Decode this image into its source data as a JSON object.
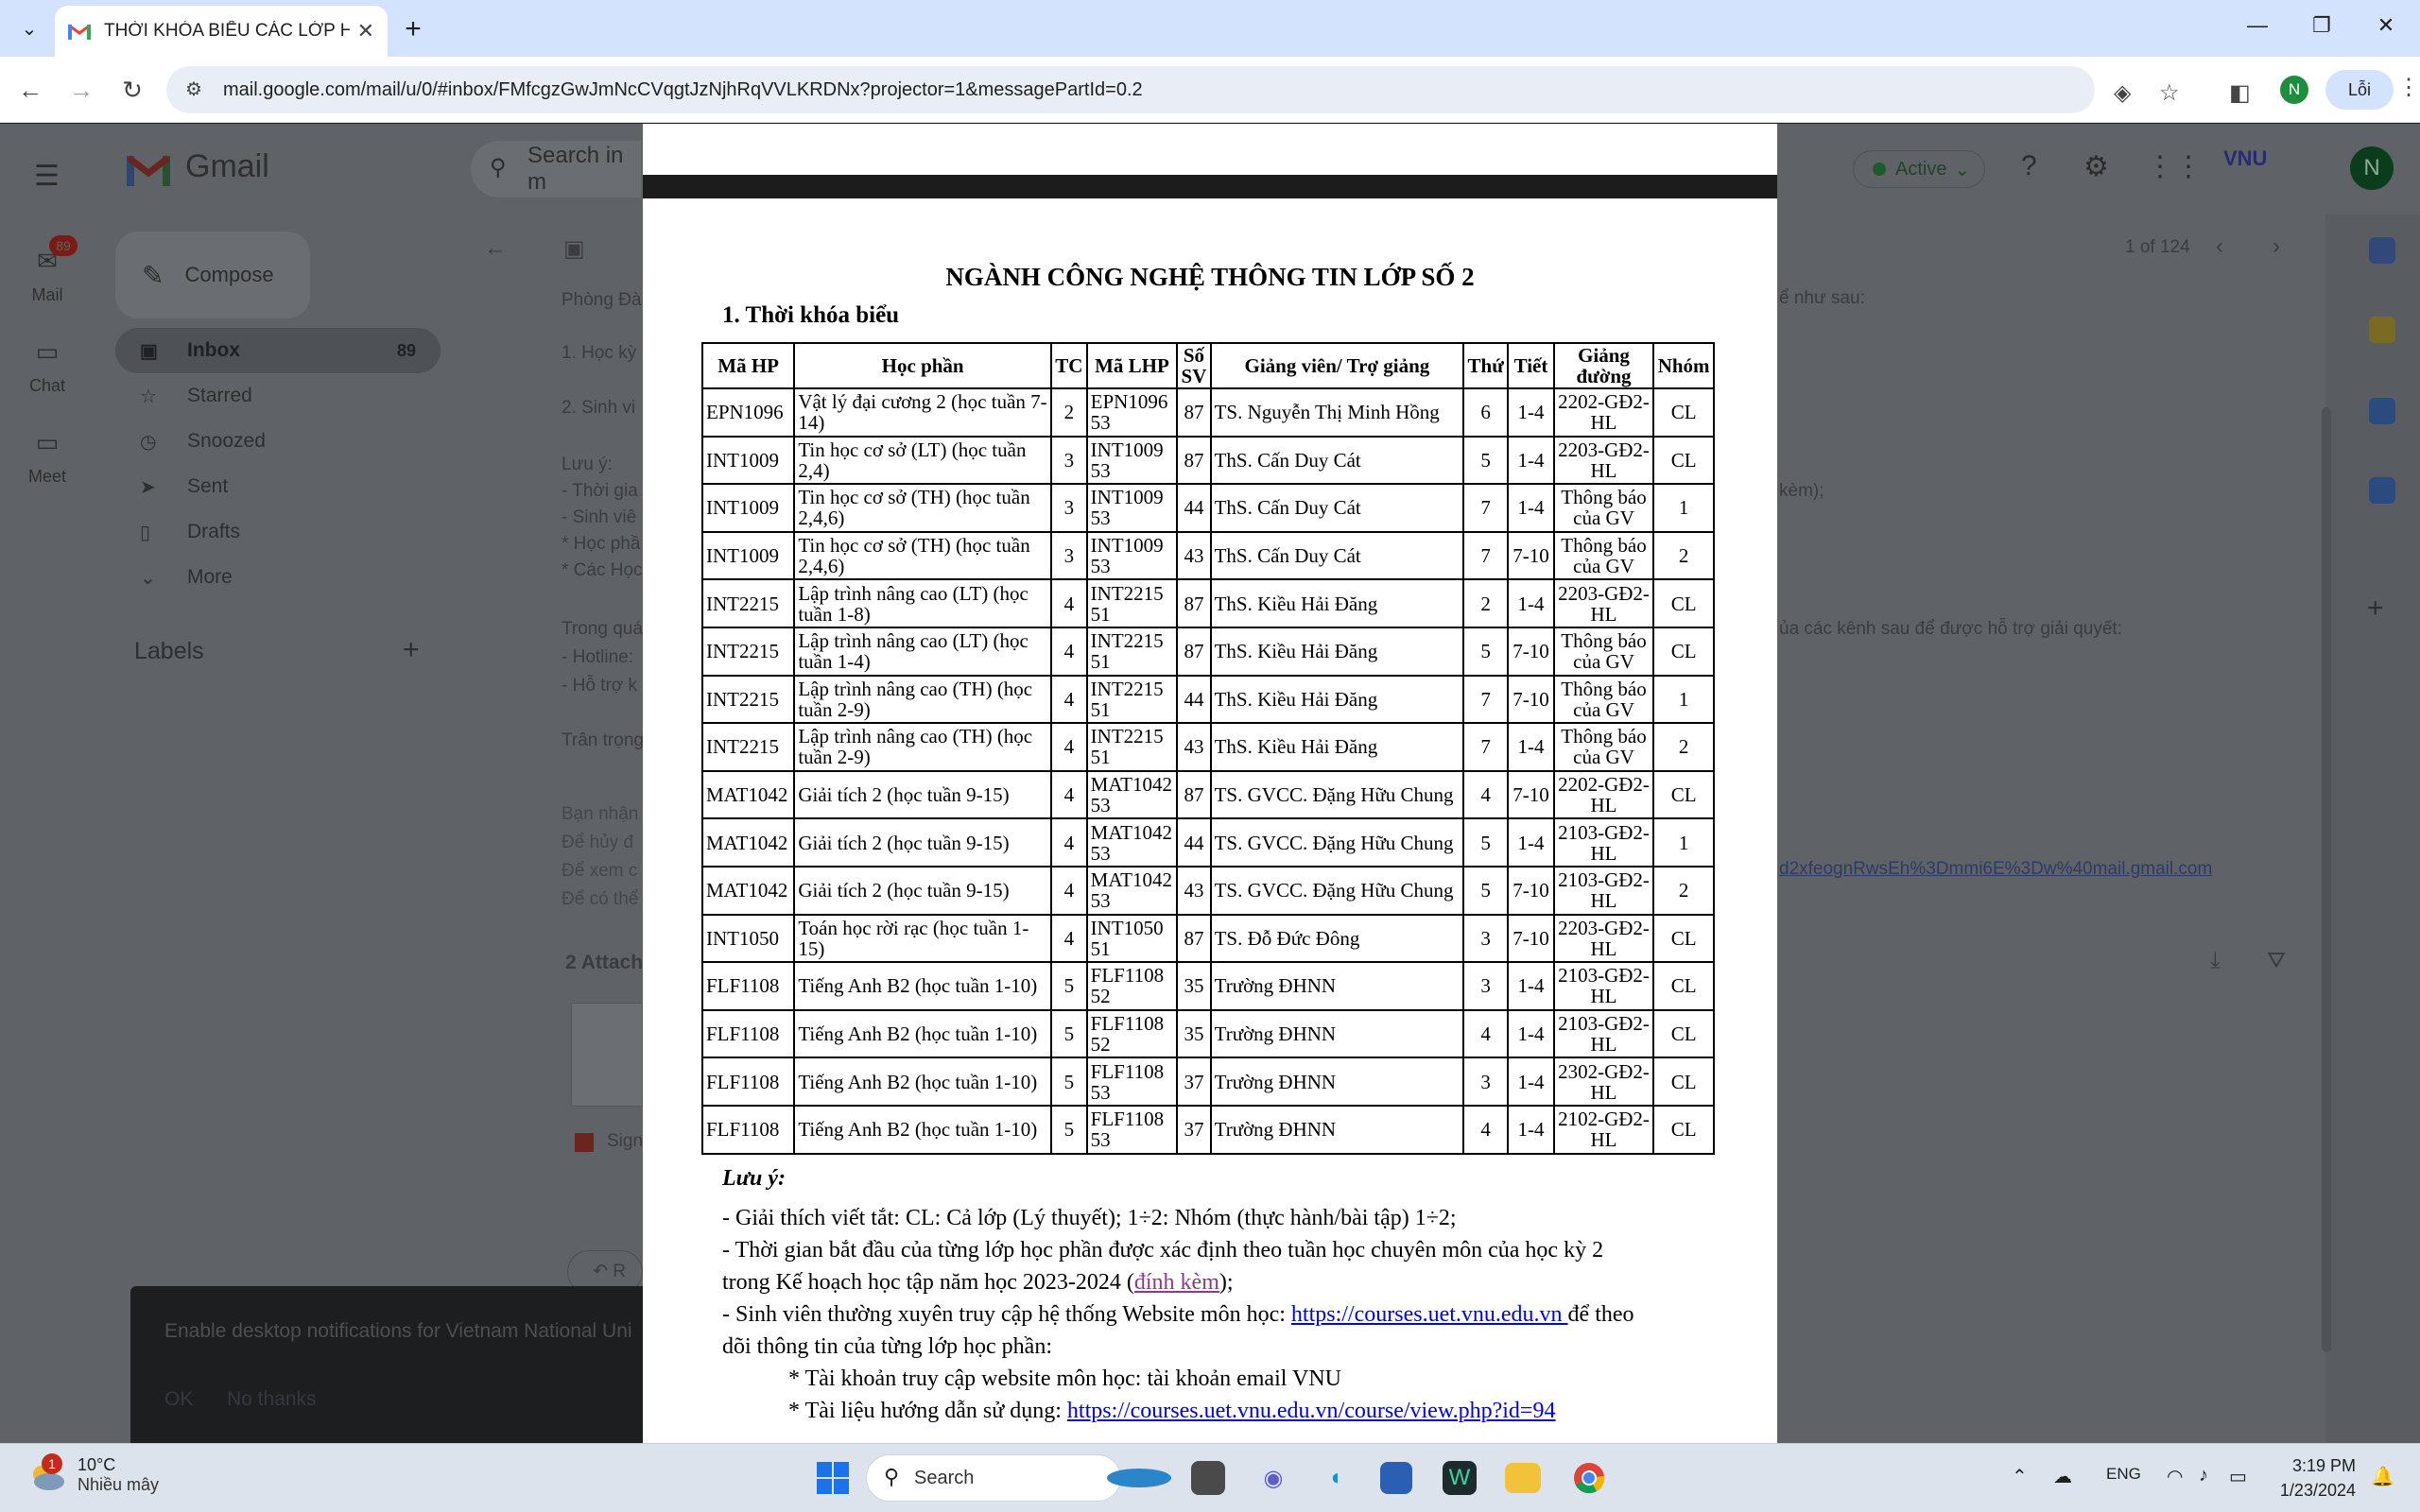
{
  "browser": {
    "tab_title": "THỜI KHÓA BIỂU CÁC LỚP HỌC",
    "url": "mail.google.com/mail/u/0/#inbox/FMfcgzGwJmNcCVqgtJzNjhRqVVLKRDNx?projector=1&messagePartId=0.2",
    "profile_initial": "N",
    "profile_label": "Lỗi"
  },
  "gmail": {
    "app_name": "Gmail",
    "search_placeholder": "Search in m",
    "status": "Active",
    "user_initial": "N",
    "vnu_logo": "VNU",
    "rail": [
      {
        "label": "Mail",
        "badge": "89"
      },
      {
        "label": "Chat"
      },
      {
        "label": "Meet"
      }
    ],
    "compose": "Compose",
    "nav": [
      {
        "label": "Inbox",
        "count": "89"
      },
      {
        "label": "Starred"
      },
      {
        "label": "Snoozed"
      },
      {
        "label": "Sent"
      },
      {
        "label": "Drafts"
      },
      {
        "label": "More"
      }
    ],
    "labels_heading": "Labels",
    "pagination": "1 of 124",
    "bg_text": {
      "line1": "Phòng Đà",
      "line2": "1. Học kỳ",
      "line3": "2. Sinh vi",
      "line4": "Lưu ý:",
      "line5": "- Thời gia",
      "line6": "- Sinh viê",
      "line7": "* Học phầ",
      "line8": "* Các Học",
      "line9": "Trong quá",
      "line10": "- Hotline:",
      "line11": "- Hỗ trợ k",
      "line12": "Trân trọng",
      "line13": "Bạn nhận",
      "line14": "Để hủy đ",
      "line15": "Để xem c",
      "line16": "Để có thể",
      "right1": "ể như sau:",
      "right2": "kèm);",
      "right3": "ủa các kênh sau để được hỗ trợ giải quyết:",
      "right4": "d2xfeognRwsEh%3Dmmi6E%3Dw%40mail.gmail.com",
      "attachments": "2 Attach",
      "sign": "Sign",
      "reply": "R"
    },
    "toast": {
      "message": "Enable desktop notifications for Vietnam National Uni",
      "ok": "OK",
      "no": "No thanks"
    }
  },
  "document": {
    "title": "NGÀNH CÔNG NGHỆ THÔNG TIN LỚP SỐ 2",
    "section": "1. Thời khóa biểu",
    "headers": [
      "Mã HP",
      "Học phần",
      "TC",
      "Mã LHP",
      "Số SV",
      "Giảng viên/ Trợ giảng",
      "Thứ",
      "Tiết",
      "Giảng đường",
      "Nhóm"
    ],
    "rows": [
      [
        "EPN1096",
        "Vật lý đại cương 2 (học tuần 7-14)",
        "2",
        "EPN1096 53",
        "87",
        "TS. Nguyễn Thị Minh Hồng",
        "6",
        "1-4",
        "2202-GĐ2-HL",
        "CL"
      ],
      [
        "INT1009",
        "Tin học cơ sở (LT) (học tuần 2,4)",
        "3",
        "INT1009 53",
        "87",
        "ThS. Cấn Duy Cát",
        "5",
        "1-4",
        "2203-GĐ2-HL",
        "CL"
      ],
      [
        "INT1009",
        "Tin học cơ sở (TH) (học tuần 2,4,6)",
        "3",
        "INT1009 53",
        "44",
        "ThS. Cấn Duy Cát",
        "7",
        "1-4",
        "Thông báo của GV",
        "1"
      ],
      [
        "INT1009",
        "Tin học cơ sở (TH) (học tuần 2,4,6)",
        "3",
        "INT1009 53",
        "43",
        "ThS. Cấn Duy Cát",
        "7",
        "7-10",
        "Thông báo của GV",
        "2"
      ],
      [
        "INT2215",
        "Lập trình nâng cao (LT) (học tuần 1-8)",
        "4",
        "INT2215 51",
        "87",
        "ThS. Kiều Hải Đăng",
        "2",
        "1-4",
        "2203-GĐ2-HL",
        "CL"
      ],
      [
        "INT2215",
        "Lập trình nâng cao (LT) (học tuần 1-4)",
        "4",
        "INT2215 51",
        "87",
        "ThS. Kiều Hải Đăng",
        "5",
        "7-10",
        "Thông báo của GV",
        "CL"
      ],
      [
        "INT2215",
        "Lập trình nâng cao (TH) (học tuần 2-9)",
        "4",
        "INT2215 51",
        "44",
        "ThS. Kiều Hải Đăng",
        "7",
        "7-10",
        "Thông báo của GV",
        "1"
      ],
      [
        "INT2215",
        "Lập trình nâng cao (TH) (học tuần 2-9)",
        "4",
        "INT2215 51",
        "43",
        "ThS. Kiều Hải Đăng",
        "7",
        "1-4",
        "Thông báo của GV",
        "2"
      ],
      [
        "MAT1042",
        "Giải tích 2 (học tuần 9-15)",
        "4",
        "MAT1042 53",
        "87",
        "TS. GVCC. Đặng Hữu Chung",
        "4",
        "7-10",
        "2202-GĐ2-HL",
        "CL"
      ],
      [
        "MAT1042",
        "Giải tích 2 (học tuần 9-15)",
        "4",
        "MAT1042 53",
        "44",
        "TS. GVCC. Đặng Hữu Chung",
        "5",
        "1-4",
        "2103-GĐ2-HL",
        "1"
      ],
      [
        "MAT1042",
        "Giải tích 2 (học tuần 9-15)",
        "4",
        "MAT1042 53",
        "43",
        "TS. GVCC. Đặng Hữu Chung",
        "5",
        "7-10",
        "2103-GĐ2-HL",
        "2"
      ],
      [
        "INT1050",
        "Toán học rời rạc (học tuần 1-15)",
        "4",
        "INT1050 51",
        "87",
        "TS. Đỗ Đức Đông",
        "3",
        "7-10",
        "2203-GĐ2-HL",
        "CL"
      ],
      [
        "FLF1108",
        "Tiếng Anh B2 (học tuần 1-10)",
        "5",
        "FLF1108 52",
        "35",
        "Trường ĐHNN",
        "3",
        "1-4",
        "2103-GĐ2-HL",
        "CL"
      ],
      [
        "FLF1108",
        "Tiếng Anh B2 (học tuần 1-10)",
        "5",
        "FLF1108 52",
        "35",
        "Trường ĐHNN",
        "4",
        "1-4",
        "2103-GĐ2-HL",
        "CL"
      ],
      [
        "FLF1108",
        "Tiếng Anh B2 (học tuần 1-10)",
        "5",
        "FLF1108 53",
        "37",
        "Trường ĐHNN",
        "3",
        "1-4",
        "2302-GĐ2-HL",
        "CL"
      ],
      [
        "FLF1108",
        "Tiếng Anh B2 (học tuần 1-10)",
        "5",
        "FLF1108 53",
        "37",
        "Trường ĐHNN",
        "4",
        "1-4",
        "2102-GĐ2-HL",
        "CL"
      ]
    ],
    "notes": {
      "heading": "Lưu ý:",
      "n1": "- Giải thích viết tắt: CL: Cả lớp (Lý thuyết); 1÷2: Nhóm (thực hành/bài tập) 1÷2;",
      "n2": "- Thời gian bắt đầu của từng lớp học phần được xác định theo tuần học chuyên môn của học kỳ 2",
      "n3_pre": "trong Kế hoạch học tập năm học 2023-2024 (",
      "n3_link": "đính kèm",
      "n3_post": ");",
      "n4_pre": "- Sinh viên thường xuyên truy cập hệ thống Website môn học: ",
      "n4_link": "https://courses.uet.vnu.edu.vn ",
      "n4_post": "để theo",
      "n5": "dõi thông tin của từng lớp học phần:",
      "n6": "* Tài khoản truy cập website môn học: tài khoản email VNU",
      "n7_pre": "* Tài liệu hướng dẫn sử dụng: ",
      "n7_link": "https://courses.uet.vnu.edu.vn/course/view.php?id=94"
    }
  },
  "taskbar": {
    "temp": "10°C",
    "weather": "Nhiều mây",
    "weather_badge": "1",
    "search": "Search",
    "lang": "ENG",
    "time": "3:19 PM",
    "date": "1/23/2024"
  },
  "colors": {
    "tab_strip": "#d3e3fd",
    "gmail_dim": "#5f6368",
    "link": "#0000ee"
  }
}
